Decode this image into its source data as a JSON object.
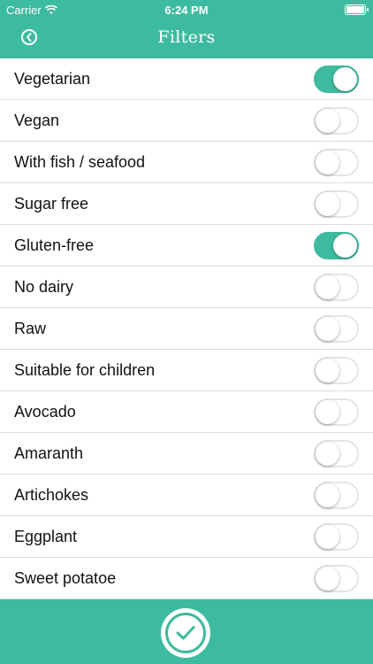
{
  "status_bar": {
    "carrier": "Carrier",
    "time": "6:24 PM"
  },
  "nav": {
    "title": "Filters"
  },
  "filters": [
    {
      "label": "Vegetarian",
      "on": true
    },
    {
      "label": "Vegan",
      "on": false
    },
    {
      "label": "With fish / seafood",
      "on": false
    },
    {
      "label": "Sugar free",
      "on": false
    },
    {
      "label": "Gluten-free",
      "on": true
    },
    {
      "label": "No dairy",
      "on": false
    },
    {
      "label": "Raw",
      "on": false
    },
    {
      "label": "Suitable for children",
      "on": false
    },
    {
      "label": "Avocado",
      "on": false
    },
    {
      "label": "Amaranth",
      "on": false
    },
    {
      "label": "Artichokes",
      "on": false
    },
    {
      "label": "Eggplant",
      "on": false
    },
    {
      "label": "Sweet potatoe",
      "on": false
    }
  ],
  "colors": {
    "accent": "#3dbba0",
    "divider": "#dcdcdc"
  },
  "icons": {
    "back": "back-arrow-circle-icon",
    "confirm": "checkmark-circle-icon",
    "wifi": "wifi-icon",
    "battery": "battery-icon"
  }
}
